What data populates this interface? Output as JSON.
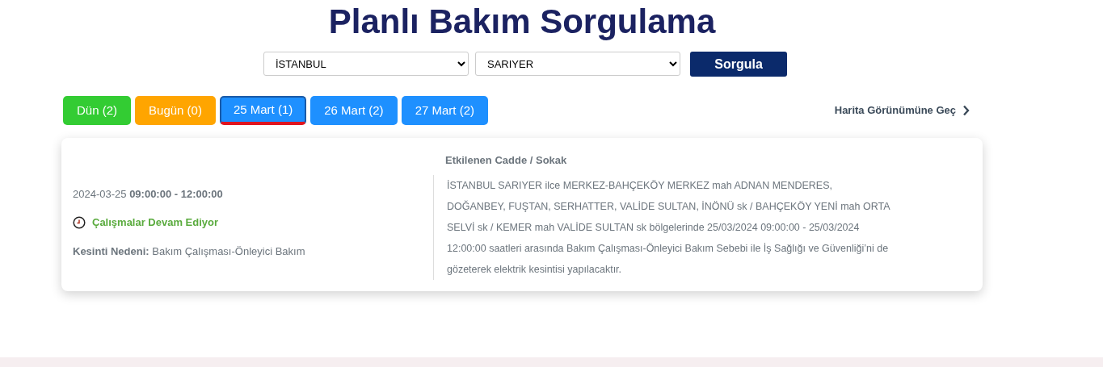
{
  "title": "Planlı Bakım Sorgulama",
  "filters": {
    "city": "İSTANBUL",
    "district": "SARIYER",
    "submit": "Sorgula"
  },
  "tabs": [
    {
      "label": "Dün (2)",
      "color": "#33cc33",
      "selected": false
    },
    {
      "label": "Bugün (0)",
      "color": "#ffa500",
      "selected": false
    },
    {
      "label": "25 Mart (1)",
      "color": "#1e90ff",
      "selected": true
    },
    {
      "label": "26 Mart (2)",
      "color": "#1e90ff",
      "selected": false
    },
    {
      "label": "27 Mart (2)",
      "color": "#1e90ff",
      "selected": false
    }
  ],
  "map_link": "Harita Görünümüne Geç",
  "outage": {
    "datetime": "2024-03-25 **09:00:00 - 12:00:00**",
    "status": "Çalışmalar Devam Ediyor",
    "reason": "**Kesinti Nedeni:** Bakım Çalışması-Önleyici Bakım",
    "streets_heading": "Etkilenen Cadde / Sokak",
    "streets": "İSTANBUL SARIYER ilce MERKEZ-BAHÇEKÖY MERKEZ mah ADNAN MENDERES, DOĞANBEY, FUŞTAN, SERHATTER, VALİDE SULTAN, İNÖNÜ sk / BAHÇEKÖY YENİ mah ORTA SELVİ sk / KEMER mah VALİDE SULTAN sk bölgelerinde 25/03/2024 09:00:00 - 25/03/2024 12:00:00 saatleri arasında Bakım Çalışması-Önleyici Bakım Sebebi ile İş Sağlığı ve Güvenliği’ni de gözeterek elektrik kesintisi yapılacaktır."
  }
}
